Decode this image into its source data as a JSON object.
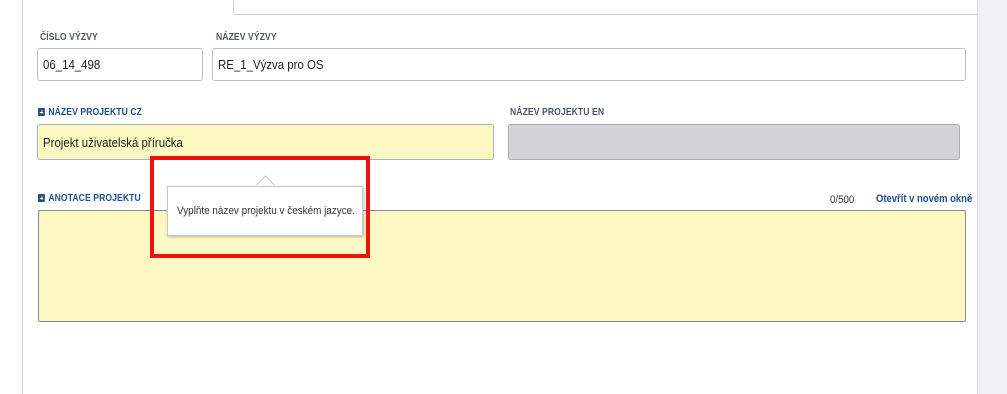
{
  "form": {
    "cislo_vyzvy": {
      "label": "ČÍSLO VÝZVY",
      "value": "06_14_498"
    },
    "nazev_vyzvy": {
      "label": "NÁZEV VÝZVY",
      "value": "RE_1_Výzva pro OS"
    },
    "nazev_projektu_cz": {
      "label": "NÁZEV PROJEKTU CZ",
      "value": "Projekt uživatelská příručka"
    },
    "nazev_projektu_en": {
      "label": "NÁZEV PROJEKTU EN",
      "value": ""
    },
    "anotace_projektu": {
      "label": "ANOTACE PROJEKTU",
      "value": "",
      "counter": "0/500",
      "open_link": "Otevřít v novém okně"
    }
  },
  "tooltip": {
    "text": "Vyplňte název projektu v českém jazyce."
  },
  "colors": {
    "required_field_bg": "#fdf7c1",
    "readonly_field_bg": "#d2d4d6",
    "highlight": "#ee1111",
    "link": "#1d4f8c"
  },
  "icons": {
    "required": "required-plus-icon"
  }
}
